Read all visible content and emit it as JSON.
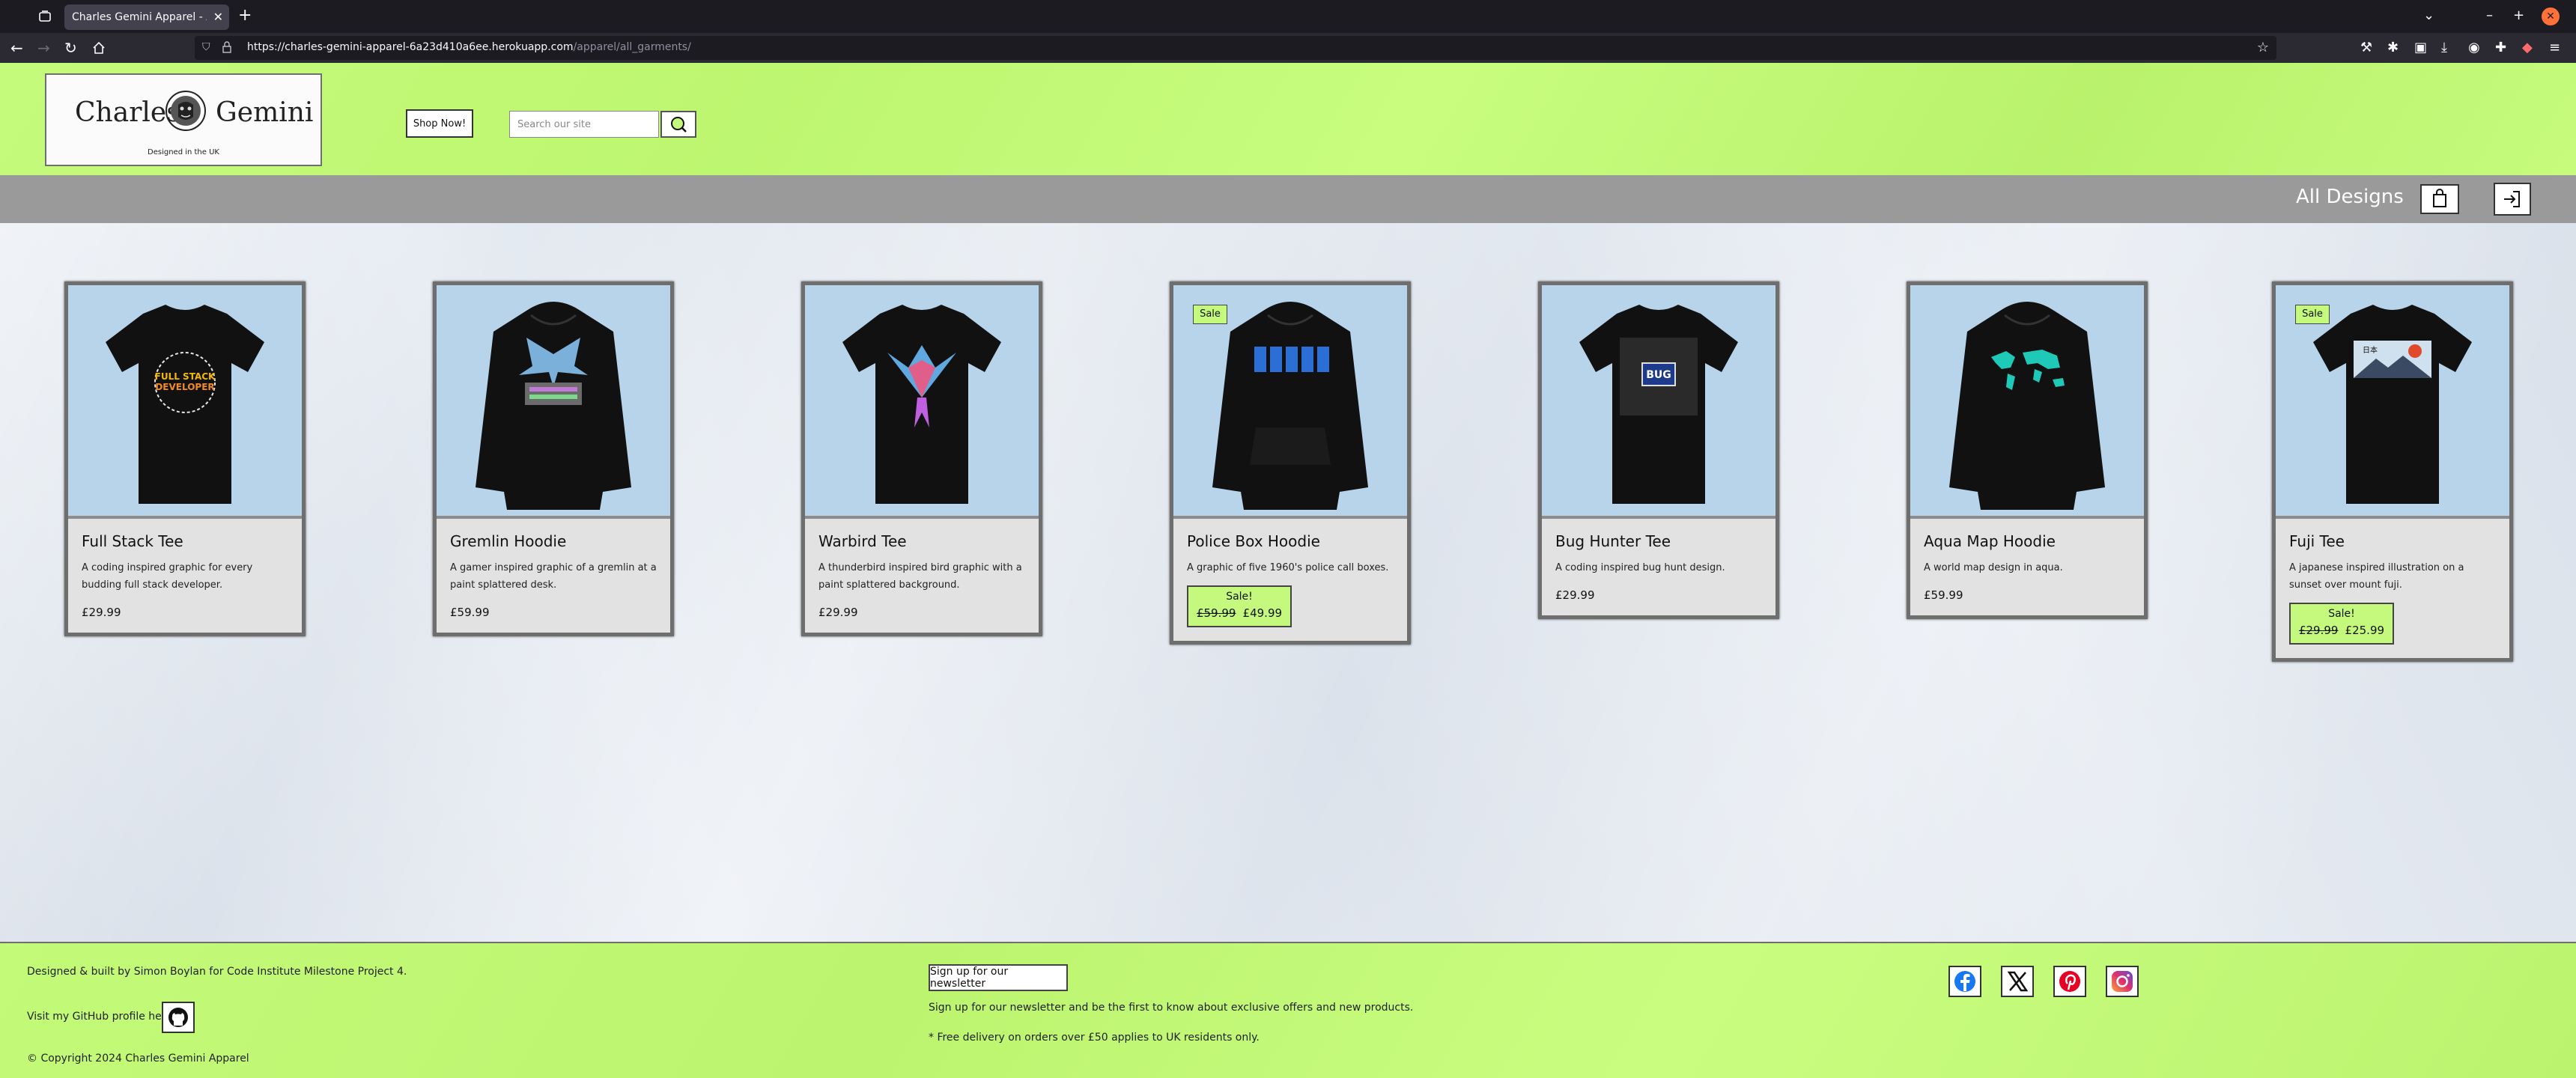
{
  "browser": {
    "tab_title": "Charles Gemini Apparel - All Designs",
    "url_domain": "https://charles-gemini-apparel-6a23d410a6ee.herokuapp.com",
    "url_path": "/apparel/all_garments/"
  },
  "header": {
    "logo_left": "Charles",
    "logo_right": "Gemini",
    "logo_tagline": "Designed in the UK",
    "shop_button": "Shop Now!",
    "search_placeholder": "Search our site"
  },
  "subbar": {
    "title": "All Designs"
  },
  "products": [
    {
      "title": "Full Stack Tee",
      "desc": "A coding inspired graphic for every budding full stack developer.",
      "price": "£29.99",
      "garment": "tee",
      "graphic": "fullstack"
    },
    {
      "title": "Gremlin Hoodie",
      "desc": "A gamer inspired graphic of a gremlin at a paint splattered desk.",
      "price": "£59.99",
      "garment": "hoodie",
      "graphic": "gremlin"
    },
    {
      "title": "Warbird Tee",
      "desc": "A thunderbird inspired bird graphic with a paint splattered background.",
      "price": "£29.99",
      "garment": "tee",
      "graphic": "warbird"
    },
    {
      "title": "Police Box Hoodie",
      "desc": "A graphic of five 1960's police call boxes.",
      "sale_badge": "Sale",
      "sale_label": "Sale!",
      "old_price": "£59.99",
      "new_price": "£49.99",
      "garment": "hoodie",
      "graphic": "policebox"
    },
    {
      "title": "Bug Hunter Tee",
      "desc": "A coding inspired bug hunt design.",
      "price": "£29.99",
      "garment": "tee",
      "graphic": "bug"
    },
    {
      "title": "Aqua Map Hoodie",
      "desc": "A world map design in aqua.",
      "price": "£59.99",
      "garment": "hoodie",
      "graphic": "map"
    },
    {
      "title": "Fuji Tee",
      "desc": "A japanese inspired illustration on a sunset over mount fuji.",
      "sale_badge": "Sale",
      "sale_label": "Sale!",
      "old_price": "£29.99",
      "new_price": "£25.99",
      "garment": "tee",
      "graphic": "fuji"
    }
  ],
  "footer": {
    "credit": "Designed & built by Simon Boylan for Code Institute Milestone Project 4.",
    "github_label": "Visit my GitHub profile here:",
    "copyright": "© Copyright 2024 Charles Gemini Apparel",
    "newsletter_button": "Sign up for our newsletter",
    "newsletter_text": "Sign up for our newsletter and be the first to know about exclusive offers and new products.",
    "delivery_text": "* Free delivery on orders over £50 applies to UK residents only."
  },
  "colors": {
    "accent_green": "#c5f97d",
    "subbar_grey": "#9a9a9a",
    "facebook": "#1877f2",
    "pinterest": "#e60023",
    "instagram": "#c13584"
  }
}
